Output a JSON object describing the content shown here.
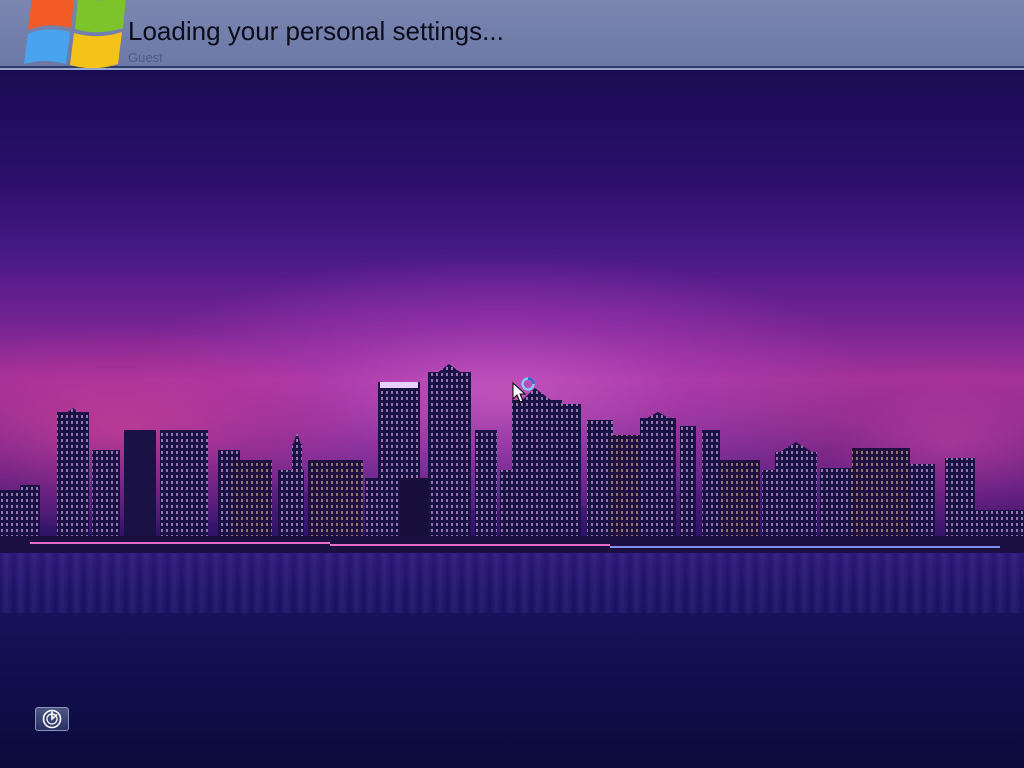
{
  "header": {
    "status_text": "Loading your personal settings...",
    "faint_text": "Guest"
  },
  "logo": {
    "icon": "windows-logo-icon",
    "colors": [
      "#f25022",
      "#7fba00",
      "#00a4ef",
      "#ffb900"
    ]
  },
  "ease_of_access": {
    "icon": "ease-of-access-icon"
  },
  "cursor": {
    "icon": "busy-cursor-icon"
  },
  "colors": {
    "header_bar": "#6c79a6",
    "sky_top": "#140a4a",
    "sky_glow": "#a23398",
    "water": "#121052"
  }
}
